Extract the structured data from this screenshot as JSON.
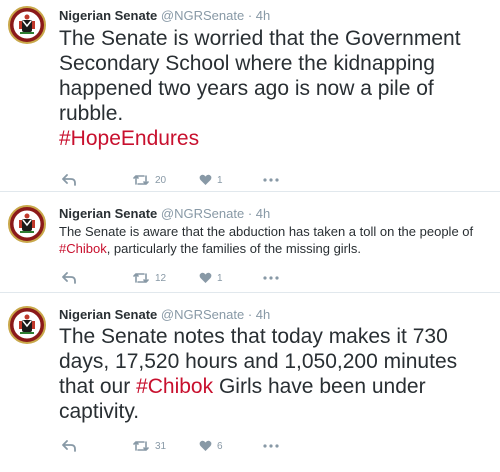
{
  "tweets": [
    {
      "name": "Nigerian Senate",
      "handle": "@NGRSenate",
      "dot": "·",
      "time": "4h",
      "text_before": "The Senate is worried that the Government Secondary School where the kidnapping happened two years ago is now a pile of rubble.",
      "hashtag": "#HopeEndures",
      "text_after": "",
      "retweets": "20",
      "likes": "1"
    },
    {
      "name": "Nigerian Senate",
      "handle": "@NGRSenate",
      "dot": "·",
      "time": "4h",
      "text_before": "The Senate is aware that the abduction has taken a toll on the people of ",
      "hashtag": "#Chibok",
      "text_after": ", particularly the families of the missing girls.",
      "retweets": "12",
      "likes": "1"
    },
    {
      "name": "Nigerian Senate",
      "handle": "@NGRSenate",
      "dot": "·",
      "time": "4h",
      "text_before": "The Senate notes that today makes it 730 days, 17,520 hours and 1,050,200 minutes that our ",
      "hashtag": "#Chibok",
      "text_after": " Girls have been under captivity.",
      "retweets": "31",
      "likes": "6"
    }
  ],
  "icons": {
    "reply": "reply-arrow-icon",
    "retweet": "retweet-icon",
    "like": "heart-icon",
    "more": "more-dots-icon",
    "avatar": "senate-coat-of-arms"
  },
  "colors": {
    "hashtag": "#c8102e",
    "muted": "#8899a6",
    "text": "#292f33",
    "divider": "#e1e8ed",
    "avatar_bg": "#8b1a1a"
  }
}
